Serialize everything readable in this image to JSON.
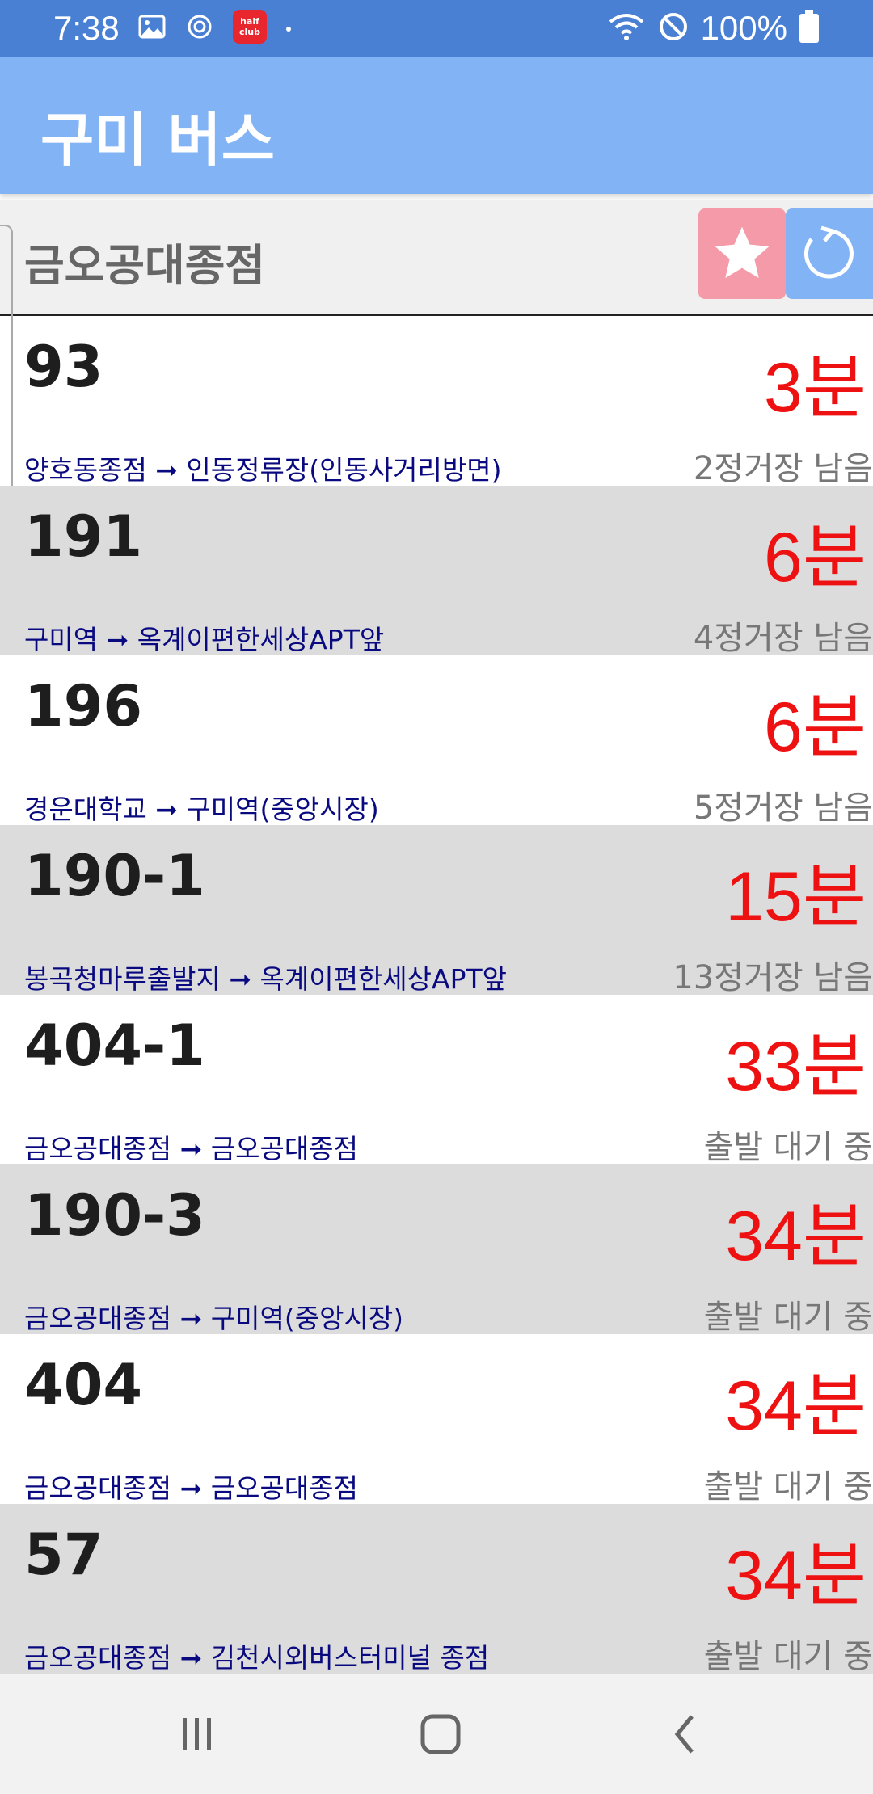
{
  "status_bar": {
    "time": "7:38",
    "app_badge": "half club",
    "battery_text": "100%"
  },
  "app_bar": {
    "title": "구미 버스"
  },
  "stop": {
    "name": "금오공대종점"
  },
  "colors": {
    "status_bar": "#4a80d4",
    "app_bar": "#82b3f5",
    "favorite_button": "#f59aa8",
    "refresh_button": "#82b3f5",
    "eta": "#ee1111",
    "direction": "#0a0a80"
  },
  "arrivals": [
    {
      "route": "93",
      "eta": "3분",
      "direction": "양호동종점 ➞ 인동정류장(인동사거리방면)",
      "remaining": "2정거장 남음"
    },
    {
      "route": "191",
      "eta": "6분",
      "direction": "구미역 ➞ 옥계이편한세상APT앞",
      "remaining": "4정거장 남음"
    },
    {
      "route": "196",
      "eta": "6분",
      "direction": "경운대학교 ➞ 구미역(중앙시장)",
      "remaining": "5정거장 남음"
    },
    {
      "route": "190-1",
      "eta": "15분",
      "direction": "봉곡청마루출발지 ➞ 옥계이편한세상APT앞",
      "remaining": "13정거장 남음"
    },
    {
      "route": "404-1",
      "eta": "33분",
      "direction": "금오공대종점 ➞ 금오공대종점",
      "remaining": "출발 대기 중"
    },
    {
      "route": "190-3",
      "eta": "34분",
      "direction": "금오공대종점 ➞ 구미역(중앙시장)",
      "remaining": "출발 대기 중"
    },
    {
      "route": "404",
      "eta": "34분",
      "direction": "금오공대종점 ➞ 금오공대종점",
      "remaining": "출발 대기 중"
    },
    {
      "route": "57",
      "eta": "34분",
      "direction": "금오공대종점 ➞ 김천시외버스터미널 종점",
      "remaining": "출발 대기 중"
    }
  ],
  "icons": {
    "favorite": "star-icon",
    "refresh": "refresh-icon",
    "nav_recents": "recents-icon",
    "nav_home": "home-icon",
    "nav_back": "back-icon"
  }
}
